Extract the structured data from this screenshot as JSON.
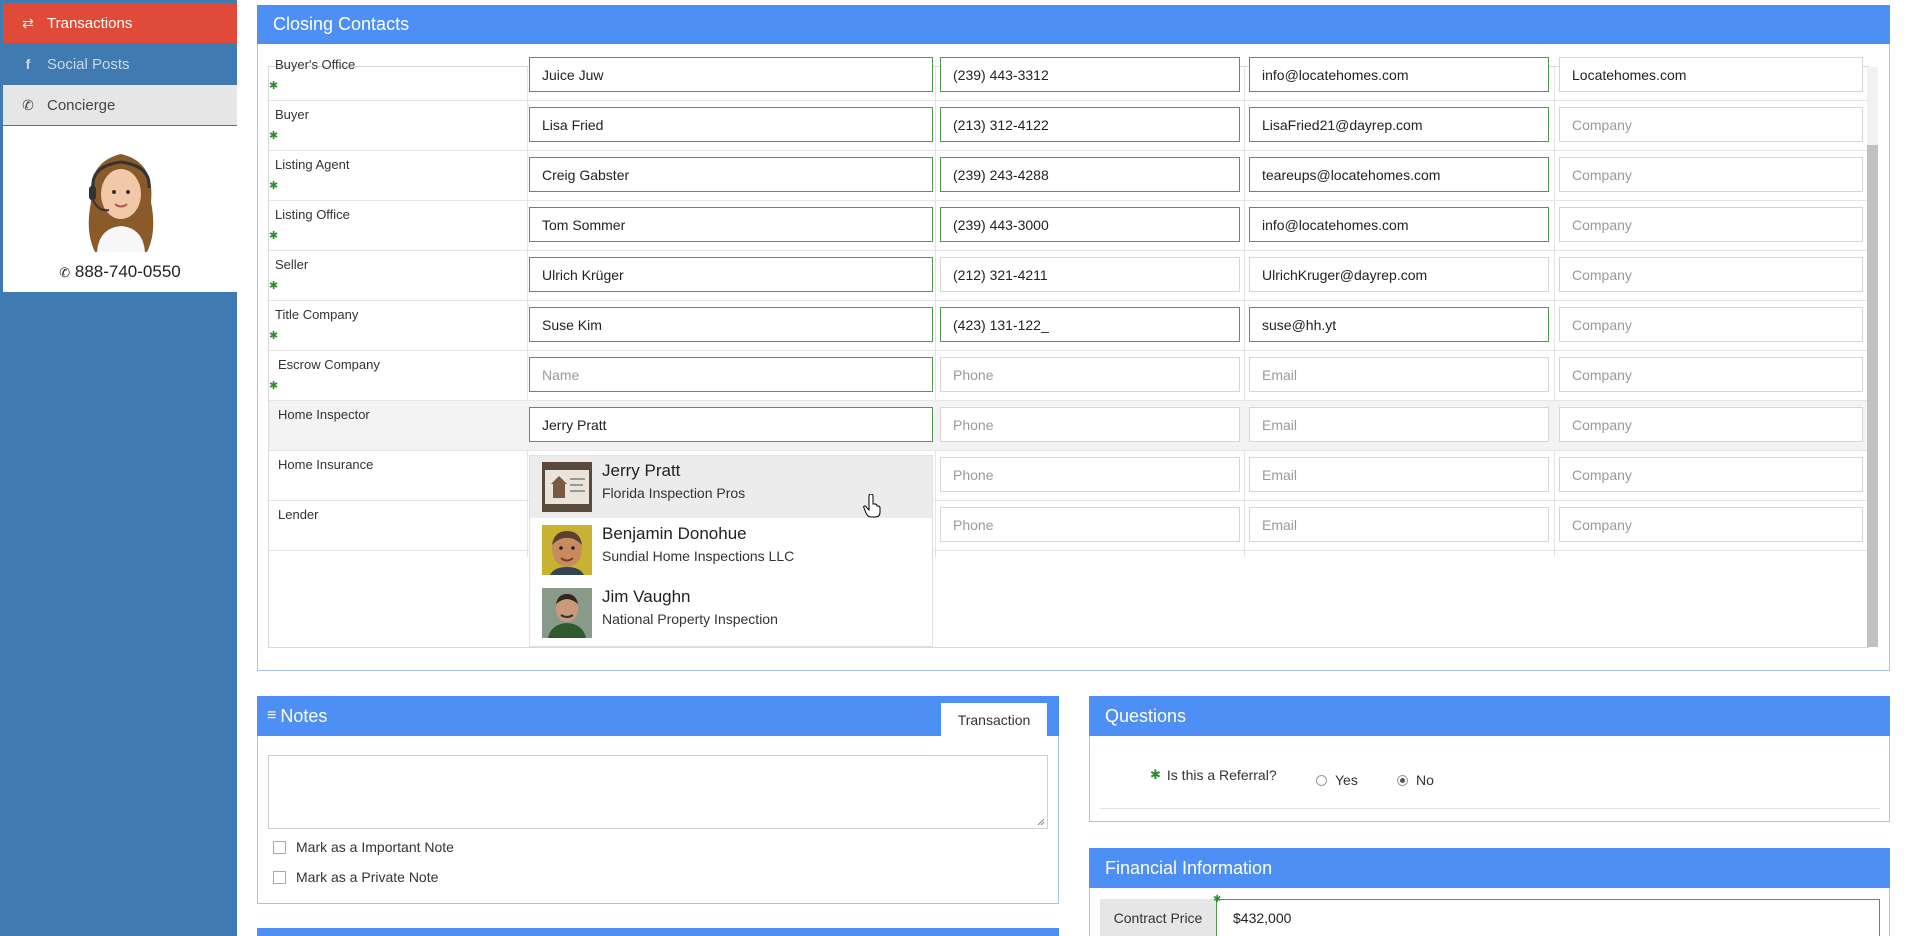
{
  "sidebar": {
    "items": [
      {
        "label": "Transactions",
        "icon": "swap-arrows-icon"
      },
      {
        "label": "Social Posts",
        "icon": "facebook-icon"
      },
      {
        "label": "Concierge",
        "icon": "phone-icon"
      }
    ],
    "concierge_phone": "888-740-0550"
  },
  "closing_contacts": {
    "title": "Closing Contacts",
    "rows": [
      {
        "role": "Buyer's Office",
        "name": "Juice Juw",
        "phone": "(239) 443-3312",
        "email": "info@locatehomes.com",
        "company": "Locatehomes.com"
      },
      {
        "role": "Buyer",
        "name": "Lisa Fried",
        "phone": "(213) 312-4122",
        "email": "LisaFried21@dayrep.com",
        "company": ""
      },
      {
        "role": "Listing Agent",
        "name": "Creig Gabster",
        "phone": "(239) 243-4288",
        "email": "teareups@locatehomes.com",
        "company": ""
      },
      {
        "role": "Listing Office",
        "name": "Tom Sommer",
        "phone": "(239) 443-3000",
        "email": "info@locatehomes.com",
        "company": ""
      },
      {
        "role": "Seller",
        "name": "Ulrich Krüger",
        "phone": "(212) 321-4211",
        "email": "UlrichKruger@dayrep.com",
        "company": ""
      },
      {
        "role": "Title Company",
        "name": "Suse Kim",
        "phone": "(423) 131-122_",
        "email": "suse@hh.yt",
        "company": ""
      },
      {
        "role": "Escrow Company",
        "name": "",
        "phone": "",
        "email": "",
        "company": ""
      },
      {
        "role": "Home Inspector",
        "name": "Jerry Pratt",
        "phone": "",
        "email": "",
        "company": ""
      },
      {
        "role": "Home Insurance",
        "name": "",
        "phone": "",
        "email": "",
        "company": ""
      },
      {
        "role": "Lender",
        "name": "",
        "phone": "",
        "email": "",
        "company": ""
      }
    ],
    "placeholders": {
      "name": "Name",
      "phone": "Phone",
      "email": "Email",
      "company": "Company"
    },
    "suggestions": [
      {
        "name": "Jerry Pratt",
        "company": "Florida Inspection Pros"
      },
      {
        "name": "Benjamin Donohue",
        "company": "Sundial Home Inspections LLC"
      },
      {
        "name": "Jim Vaughn",
        "company": "National Property Inspection"
      }
    ]
  },
  "notes": {
    "title": "Notes",
    "tab": "Transaction",
    "important_label": "Mark as a Important Note",
    "private_label": "Mark as a Private Note"
  },
  "questions": {
    "title": "Questions",
    "referral_label": "Is this a Referral?",
    "yes_label": "Yes",
    "no_label": "No",
    "selected": "No"
  },
  "financial": {
    "title": "Financial Information",
    "contract_price_label": "Contract Price",
    "contract_price_value": "$432,000"
  },
  "colors": {
    "accent": "#4d8ff5",
    "sidebar": "#3f7ab0",
    "active_nav": "#e04a39",
    "required": "#2e8b2e"
  }
}
